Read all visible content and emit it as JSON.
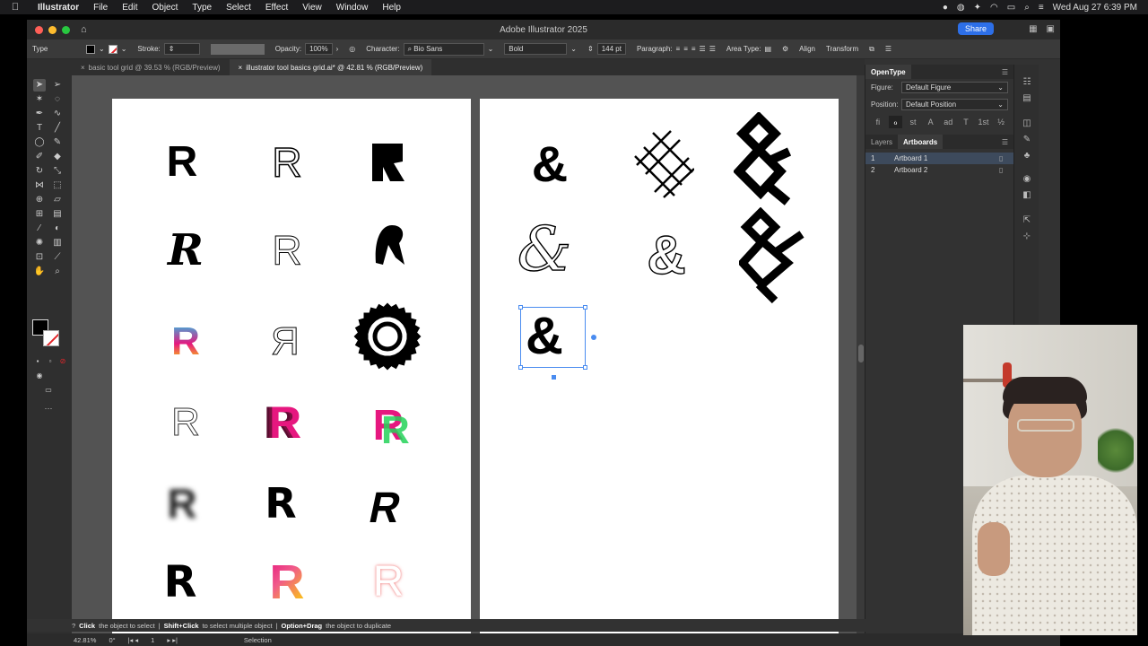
{
  "menubar": {
    "app": "Illustrator",
    "items": [
      "File",
      "Edit",
      "Object",
      "Type",
      "Select",
      "Effect",
      "View",
      "Window",
      "Help"
    ],
    "clock": "Wed Aug 27  6:39 PM"
  },
  "window": {
    "title": "Adobe Illustrator 2025",
    "share_label": "Share"
  },
  "control": {
    "tool_label": "Type",
    "stroke_label": "Stroke:",
    "opacity_label": "Opacity:",
    "opacity_value": "100%",
    "character_label": "Character:",
    "font_family": "Bio Sans",
    "font_style": "Bold",
    "font_size": "144 pt",
    "paragraph_label": "Paragraph:",
    "area_type_label": "Area Type:",
    "align_label": "Align",
    "transform_label": "Transform"
  },
  "tabs": [
    {
      "label": "basic tool grid @ 39.53 % (RGB/Preview)",
      "active": false
    },
    {
      "label": "illustrator tool basics grid.ai* @ 42.81 % (RGB/Preview)",
      "active": true
    }
  ],
  "artboard1_glyphs": [
    "R",
    "R",
    "R",
    "R",
    "R",
    "R",
    "R",
    "R",
    "R",
    "R",
    "R",
    "R",
    "R",
    "R",
    "R",
    "R",
    "R",
    "R"
  ],
  "artboard2_glyphs": [
    "&",
    "&",
    "&",
    "&",
    "&",
    "&",
    "&"
  ],
  "opentype": {
    "panel_title": "OpenType",
    "figure_label": "Figure:",
    "figure_value": "Default Figure",
    "position_label": "Position:",
    "position_value": "Default Position",
    "buttons": [
      "fi",
      "ℴ",
      "st",
      "A",
      "ad",
      "T",
      "1st",
      "½"
    ]
  },
  "layers_panel": {
    "tabs": [
      "Layers",
      "Artboards"
    ],
    "active_tab": "Artboards",
    "artboards": [
      {
        "num": "1",
        "name": "Artboard 1",
        "selected": true
      },
      {
        "num": "2",
        "name": "Artboard 2",
        "selected": false
      }
    ]
  },
  "status": {
    "hint_click": "Click",
    "hint_click_text": "the object to select",
    "hint_shift": "Shift+Click",
    "hint_shift_text": "to select multiple object",
    "hint_option": "Option+Drag",
    "hint_option_text": "the object to duplicate"
  },
  "bottom": {
    "zoom": "42.81%",
    "rotation": "0°",
    "artboard_num": "1",
    "mode": "Selection"
  },
  "colors": {
    "accent": "#2d6fe8",
    "selection": "#4a8cf0",
    "pink": "#e6177f",
    "yellow": "#fcd800"
  }
}
